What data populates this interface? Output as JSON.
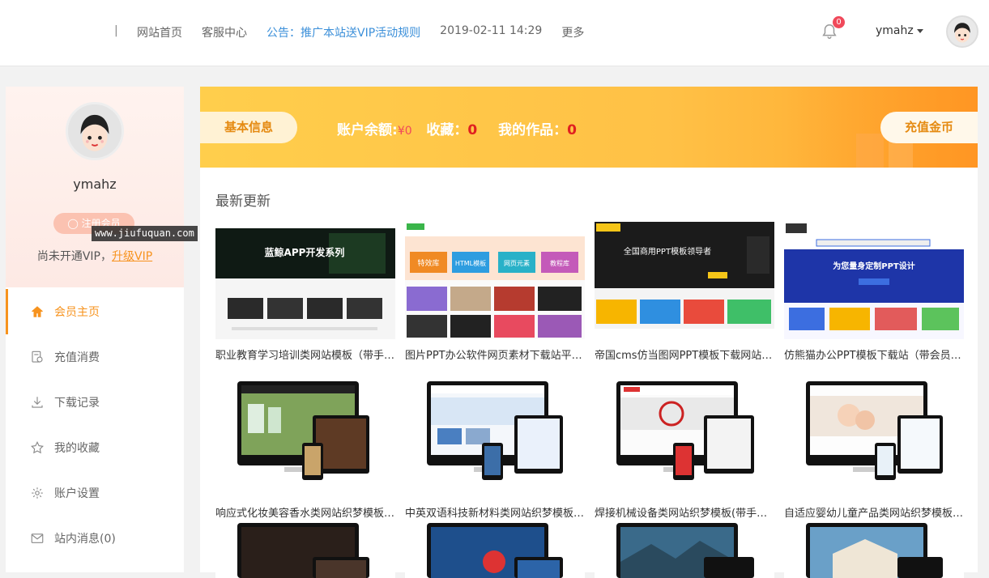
{
  "header": {
    "separator": "|",
    "nav": [
      "网站首页",
      "客服中心"
    ],
    "notice": "公告：推广本站送VIP活动规则",
    "datetime": "2019-02-11 14:29",
    "more": "更多",
    "bell_count": "0",
    "username": "ymahz"
  },
  "sidebar": {
    "username": "ymahz",
    "register_label": "注册会员",
    "vip_text": "尚未开通VIP，",
    "upgrade_label": "升级VIP",
    "menu": [
      {
        "label": "会员主页",
        "icon": "home-icon"
      },
      {
        "label": "充值消费",
        "icon": "recharge-icon"
      },
      {
        "label": "下载记录",
        "icon": "download-icon"
      },
      {
        "label": "我的收藏",
        "icon": "star-icon"
      },
      {
        "label": "账户设置",
        "icon": "gear-icon"
      },
      {
        "label": "站内消息(0)",
        "icon": "mail-icon"
      }
    ]
  },
  "watermark": "www.jiufuquan.com",
  "banner": {
    "basic_info": "基本信息",
    "balance_label": "账户余额:",
    "balance_value": "¥0",
    "fav_label": "收藏：",
    "fav_value": "0",
    "works_label": "我的作品：",
    "works_value": "0",
    "recharge_button": "充值金币"
  },
  "main": {
    "section_title": "最新更新",
    "items": [
      {
        "caption": "职业教育学习培训类网站模板（带手机端）"
      },
      {
        "caption": "图片PPT办公软件网页素材下载站平台源码"
      },
      {
        "caption": "帝国cms仿当图网PPT模板下载网站源码"
      },
      {
        "caption": "仿熊猫办公PPT模板下载站（带会员、支付）"
      },
      {
        "caption": "响应式化妆美容香水类网站织梦模板(自适应)"
      },
      {
        "caption": "中英双语科技新材料类网站织梦模板（带手机）"
      },
      {
        "caption": "焊接机械设备类网站织梦模板(带手机端)"
      },
      {
        "caption": "自适应婴幼儿童产品类网站织梦模板(响应式)"
      }
    ],
    "thumb_texts": {
      "t1": "蓝鲸APP开发系列",
      "t2a": "特效库",
      "t2b": "HTML模板",
      "t2c": "网页元素",
      "t2d": "教程库",
      "t3": "全国商用PPT模板领导者",
      "t4": "为您量身定制PPT设计"
    }
  },
  "colors": {
    "accent": "#f7931e",
    "notice_blue": "#3b8fd9",
    "badge_red": "#f0495a"
  }
}
